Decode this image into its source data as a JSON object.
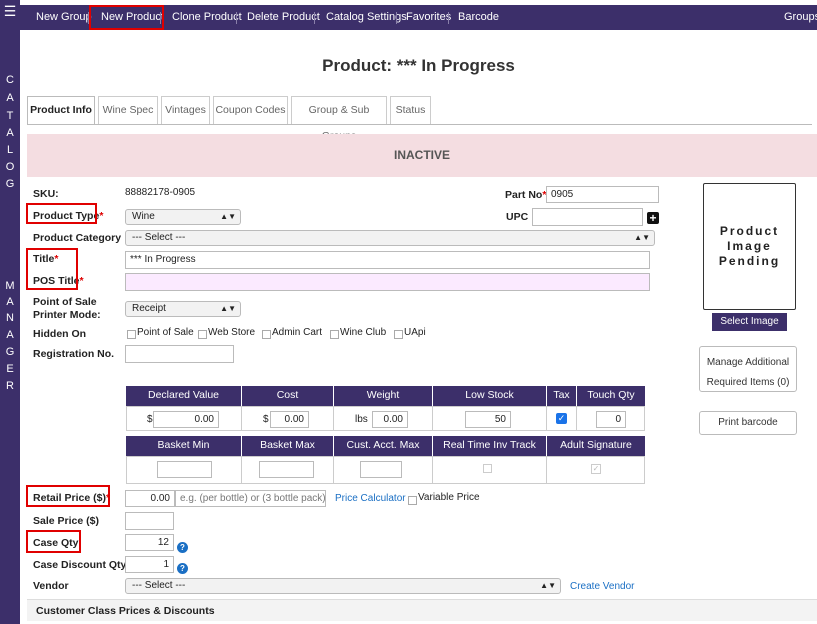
{
  "sidebar": {
    "menu_icon": "hamburger-icon",
    "word_catalog": [
      "C",
      "A",
      "T",
      "A",
      "L",
      "O",
      "G"
    ],
    "word_manager": [
      "M",
      "A",
      "N",
      "A",
      "G",
      "E",
      "R"
    ]
  },
  "nav": {
    "items": [
      "New Group",
      "New Product",
      "Clone Product",
      "Delete Product",
      "Catalog Settings",
      "Favorites",
      "Barcode"
    ],
    "right": "Groups"
  },
  "page_title": "Product: *** In Progress",
  "tabs": [
    "Product Info",
    "Wine Spec",
    "Vintages",
    "Coupon Codes",
    "Group & Sub Groups",
    "Status"
  ],
  "status_banner": "INACTIVE",
  "form": {
    "sku_label": "SKU:",
    "sku_value": "88882178-0905",
    "part_no_label": "Part No",
    "part_no_value": "0905",
    "upc_label": "UPC",
    "upc_value": "",
    "product_type_label": "Product Type",
    "product_type_value": "Wine",
    "product_category_label": "Product Category",
    "product_category_value": "--- Select ---",
    "title_label": "Title",
    "title_value": "*** In Progress",
    "pos_title_label": "POS Title",
    "pos_title_value": "",
    "pos_printer_label_1": "Point of Sale",
    "pos_printer_label_2": "Printer Mode:",
    "pos_printer_value": "Receipt",
    "hidden_on_label": "Hidden On",
    "hidden_on_options": [
      "Point of Sale",
      "Web Store",
      "Admin Cart",
      "Wine Club",
      "UApi"
    ],
    "registration_label": "Registration No.",
    "registration_value": ""
  },
  "image": {
    "placeholder_line1": "Product",
    "placeholder_line2": "Image",
    "placeholder_line3": "Pending",
    "select_button": "Select Image",
    "manage_line1": "Manage Additional",
    "manage_line2": "Required Items (0)",
    "print_barcode": "Print barcode"
  },
  "grid": {
    "headers_row1": [
      "Declared Value",
      "Cost",
      "Weight",
      "Low Stock",
      "Tax",
      "Touch Qty"
    ],
    "declared_prefix": "$",
    "declared_value": "0.00",
    "cost_prefix": "$",
    "cost_value": "0.00",
    "weight_prefix": "lbs",
    "weight_value": "0.00",
    "low_stock_value": "50",
    "tax_checked": true,
    "touch_qty_value": "0",
    "headers_row2": [
      "Basket Min",
      "Basket Max",
      "Cust. Acct. Max",
      "Real Time Inv Track",
      "Adult Signature"
    ],
    "real_time_checked": false,
    "adult_signature_checked": true
  },
  "pricing": {
    "retail_label": "Retail Price ($)",
    "retail_value": "0.00",
    "retail_placeholder": "e.g. (per bottle) or (3 bottle pack)",
    "price_calculator": "Price Calculator",
    "variable_price": "Variable Price",
    "sale_label": "Sale Price ($)",
    "sale_value": "",
    "case_qty_label": "Case Qty",
    "case_qty_value": "12",
    "case_discount_label": "Case Discount Qty",
    "case_discount_value": "1",
    "vendor_label": "Vendor",
    "vendor_value": "--- Select ---",
    "create_vendor": "Create Vendor"
  },
  "customer_class_header": "Customer Class Prices & Discounts",
  "colors": {
    "brand_purple": "#3c2f6a",
    "inactive_bg": "#f4dde1",
    "highlight_red": "#e00000",
    "link_blue": "#1a6fc4",
    "pos_title_bg": "#fbeaff"
  }
}
